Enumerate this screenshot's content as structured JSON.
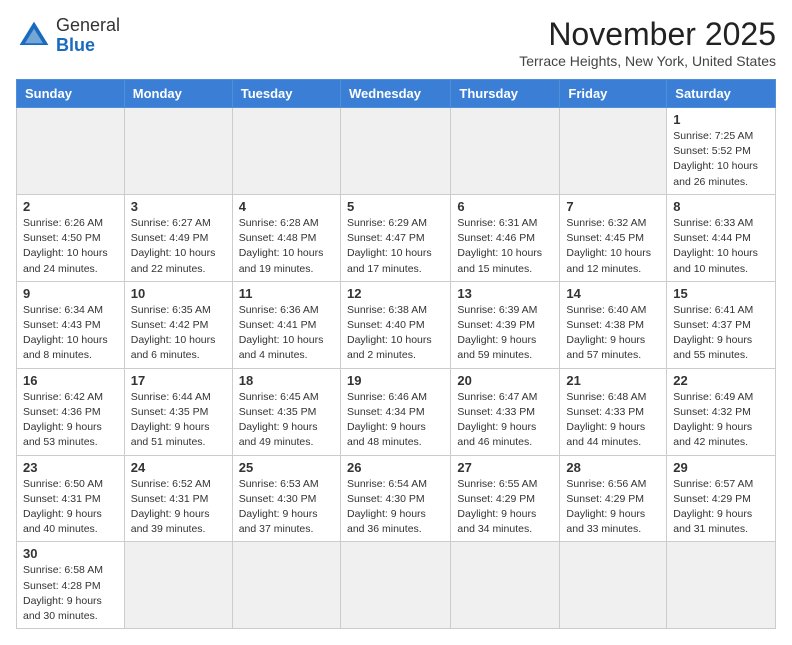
{
  "logo": {
    "general": "General",
    "blue": "Blue"
  },
  "title": "November 2025",
  "subtitle": "Terrace Heights, New York, United States",
  "headers": [
    "Sunday",
    "Monday",
    "Tuesday",
    "Wednesday",
    "Thursday",
    "Friday",
    "Saturday"
  ],
  "weeks": [
    [
      {
        "day": "",
        "info": "",
        "empty": true
      },
      {
        "day": "",
        "info": "",
        "empty": true
      },
      {
        "day": "",
        "info": "",
        "empty": true
      },
      {
        "day": "",
        "info": "",
        "empty": true
      },
      {
        "day": "",
        "info": "",
        "empty": true
      },
      {
        "day": "",
        "info": "",
        "empty": true
      },
      {
        "day": "1",
        "info": "Sunrise: 7:25 AM\nSunset: 5:52 PM\nDaylight: 10 hours and 26 minutes.",
        "empty": false
      }
    ],
    [
      {
        "day": "2",
        "info": "Sunrise: 6:26 AM\nSunset: 4:50 PM\nDaylight: 10 hours and 24 minutes.",
        "empty": false
      },
      {
        "day": "3",
        "info": "Sunrise: 6:27 AM\nSunset: 4:49 PM\nDaylight: 10 hours and 22 minutes.",
        "empty": false
      },
      {
        "day": "4",
        "info": "Sunrise: 6:28 AM\nSunset: 4:48 PM\nDaylight: 10 hours and 19 minutes.",
        "empty": false
      },
      {
        "day": "5",
        "info": "Sunrise: 6:29 AM\nSunset: 4:47 PM\nDaylight: 10 hours and 17 minutes.",
        "empty": false
      },
      {
        "day": "6",
        "info": "Sunrise: 6:31 AM\nSunset: 4:46 PM\nDaylight: 10 hours and 15 minutes.",
        "empty": false
      },
      {
        "day": "7",
        "info": "Sunrise: 6:32 AM\nSunset: 4:45 PM\nDaylight: 10 hours and 12 minutes.",
        "empty": false
      },
      {
        "day": "8",
        "info": "Sunrise: 6:33 AM\nSunset: 4:44 PM\nDaylight: 10 hours and 10 minutes.",
        "empty": false
      }
    ],
    [
      {
        "day": "9",
        "info": "Sunrise: 6:34 AM\nSunset: 4:43 PM\nDaylight: 10 hours and 8 minutes.",
        "empty": false
      },
      {
        "day": "10",
        "info": "Sunrise: 6:35 AM\nSunset: 4:42 PM\nDaylight: 10 hours and 6 minutes.",
        "empty": false
      },
      {
        "day": "11",
        "info": "Sunrise: 6:36 AM\nSunset: 4:41 PM\nDaylight: 10 hours and 4 minutes.",
        "empty": false
      },
      {
        "day": "12",
        "info": "Sunrise: 6:38 AM\nSunset: 4:40 PM\nDaylight: 10 hours and 2 minutes.",
        "empty": false
      },
      {
        "day": "13",
        "info": "Sunrise: 6:39 AM\nSunset: 4:39 PM\nDaylight: 9 hours and 59 minutes.",
        "empty": false
      },
      {
        "day": "14",
        "info": "Sunrise: 6:40 AM\nSunset: 4:38 PM\nDaylight: 9 hours and 57 minutes.",
        "empty": false
      },
      {
        "day": "15",
        "info": "Sunrise: 6:41 AM\nSunset: 4:37 PM\nDaylight: 9 hours and 55 minutes.",
        "empty": false
      }
    ],
    [
      {
        "day": "16",
        "info": "Sunrise: 6:42 AM\nSunset: 4:36 PM\nDaylight: 9 hours and 53 minutes.",
        "empty": false
      },
      {
        "day": "17",
        "info": "Sunrise: 6:44 AM\nSunset: 4:35 PM\nDaylight: 9 hours and 51 minutes.",
        "empty": false
      },
      {
        "day": "18",
        "info": "Sunrise: 6:45 AM\nSunset: 4:35 PM\nDaylight: 9 hours and 49 minutes.",
        "empty": false
      },
      {
        "day": "19",
        "info": "Sunrise: 6:46 AM\nSunset: 4:34 PM\nDaylight: 9 hours and 48 minutes.",
        "empty": false
      },
      {
        "day": "20",
        "info": "Sunrise: 6:47 AM\nSunset: 4:33 PM\nDaylight: 9 hours and 46 minutes.",
        "empty": false
      },
      {
        "day": "21",
        "info": "Sunrise: 6:48 AM\nSunset: 4:33 PM\nDaylight: 9 hours and 44 minutes.",
        "empty": false
      },
      {
        "day": "22",
        "info": "Sunrise: 6:49 AM\nSunset: 4:32 PM\nDaylight: 9 hours and 42 minutes.",
        "empty": false
      }
    ],
    [
      {
        "day": "23",
        "info": "Sunrise: 6:50 AM\nSunset: 4:31 PM\nDaylight: 9 hours and 40 minutes.",
        "empty": false
      },
      {
        "day": "24",
        "info": "Sunrise: 6:52 AM\nSunset: 4:31 PM\nDaylight: 9 hours and 39 minutes.",
        "empty": false
      },
      {
        "day": "25",
        "info": "Sunrise: 6:53 AM\nSunset: 4:30 PM\nDaylight: 9 hours and 37 minutes.",
        "empty": false
      },
      {
        "day": "26",
        "info": "Sunrise: 6:54 AM\nSunset: 4:30 PM\nDaylight: 9 hours and 36 minutes.",
        "empty": false
      },
      {
        "day": "27",
        "info": "Sunrise: 6:55 AM\nSunset: 4:29 PM\nDaylight: 9 hours and 34 minutes.",
        "empty": false
      },
      {
        "day": "28",
        "info": "Sunrise: 6:56 AM\nSunset: 4:29 PM\nDaylight: 9 hours and 33 minutes.",
        "empty": false
      },
      {
        "day": "29",
        "info": "Sunrise: 6:57 AM\nSunset: 4:29 PM\nDaylight: 9 hours and 31 minutes.",
        "empty": false
      }
    ],
    [
      {
        "day": "30",
        "info": "Sunrise: 6:58 AM\nSunset: 4:28 PM\nDaylight: 9 hours and 30 minutes.",
        "empty": false
      },
      {
        "day": "",
        "info": "",
        "empty": true
      },
      {
        "day": "",
        "info": "",
        "empty": true
      },
      {
        "day": "",
        "info": "",
        "empty": true
      },
      {
        "day": "",
        "info": "",
        "empty": true
      },
      {
        "day": "",
        "info": "",
        "empty": true
      },
      {
        "day": "",
        "info": "",
        "empty": true
      }
    ]
  ]
}
